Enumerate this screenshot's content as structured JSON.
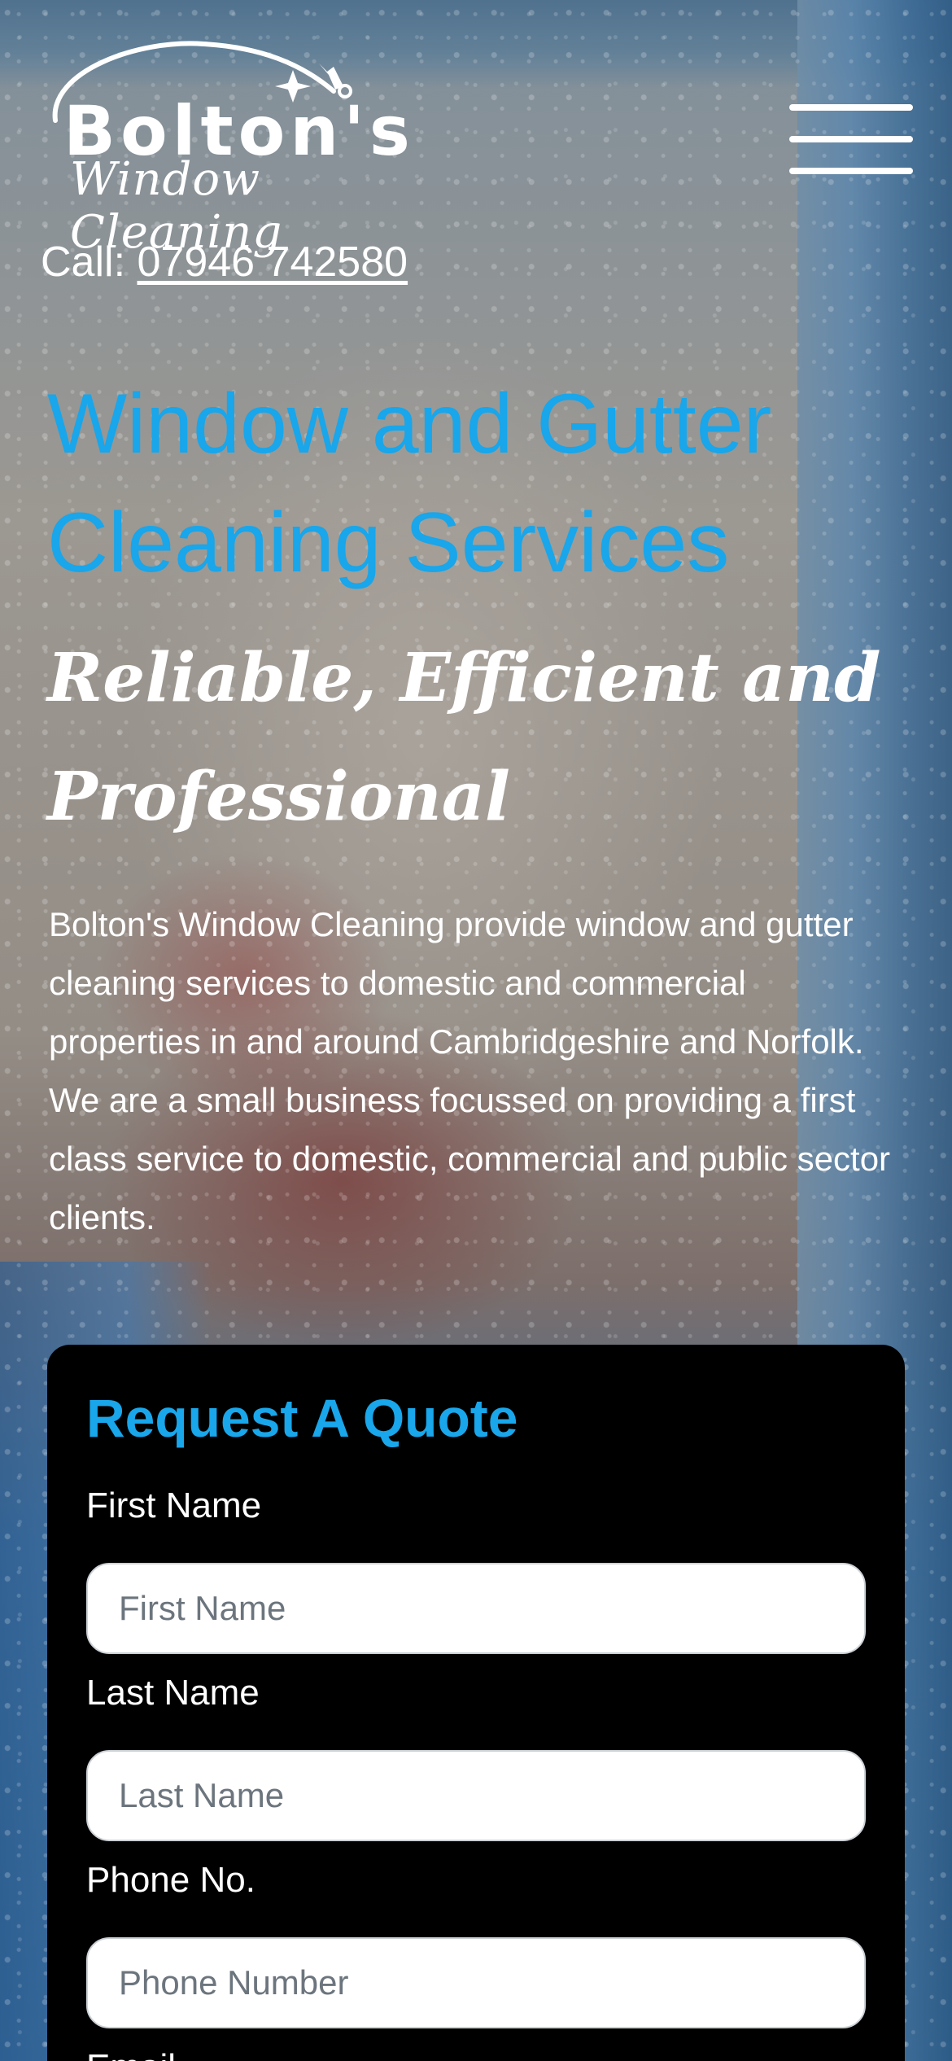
{
  "brand": {
    "name": "Bolton's",
    "tagline": "Window Cleaning"
  },
  "header": {
    "call_prefix": "Call:",
    "phone": "07946 742580",
    "menu_icon": "hamburger-menu-icon"
  },
  "hero": {
    "title": "Window and Gutter Cleaning Services",
    "subtitle": "Reliable, Efficient and Professional",
    "description": "Bolton's Window Cleaning provide window and gutter cleaning services to domestic and commercial properties in and around Cambridgeshire and Norfolk. We are a small business focussed on providing a first class service to domestic, commercial and public sector clients."
  },
  "quote_form": {
    "title": "Request A Quote",
    "fields": [
      {
        "label": "First Name",
        "placeholder": "First Name"
      },
      {
        "label": "Last Name",
        "placeholder": "Last Name"
      },
      {
        "label": "Phone No.",
        "placeholder": "Phone Number"
      },
      {
        "label": "Email",
        "placeholder": ""
      }
    ]
  },
  "colors": {
    "accent_blue": "#19a6ea",
    "form_background": "#000000",
    "text": "#ffffff"
  }
}
